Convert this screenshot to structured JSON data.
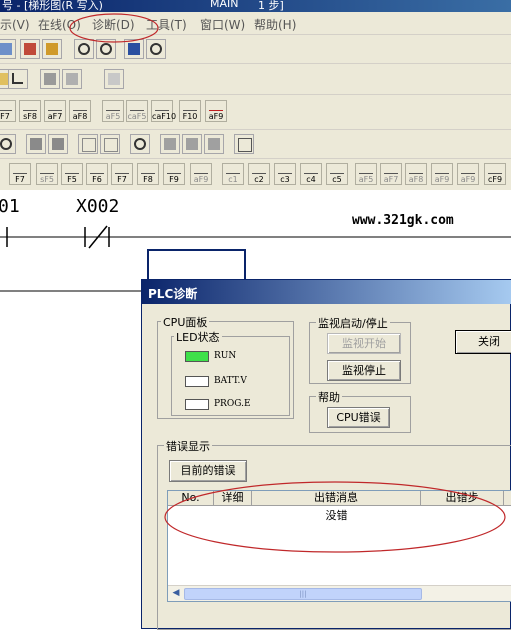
{
  "titlebar": {
    "fragment1": "号 - [梯形图(R 写入)",
    "fragment2": "MAIN",
    "fragment3": "1 步]"
  },
  "menu": {
    "items": [
      "示(V)",
      "在线(O)",
      "诊断(D)",
      "工具(T)",
      "窗口(W)",
      "帮助(H)"
    ]
  },
  "toolbar_keys": {
    "row3": [
      "F7",
      "sF8",
      "aF7",
      "aF8",
      "aF5",
      "caF5",
      "caF10",
      "F10",
      "aF9"
    ],
    "row5": [
      "F7",
      "sF5",
      "F5",
      "F6",
      "F7",
      "F8",
      "F9",
      "aF9",
      "c1",
      "c2",
      "c3",
      "c4",
      "c5",
      "aF5",
      "aF7",
      "aF8",
      "aF9",
      "aF9",
      "cF9"
    ]
  },
  "ladder": {
    "contact_left_label": "01",
    "contact_label": "X002",
    "watermark": "www.321gk.com"
  },
  "dialog": {
    "title": "PLC诊断",
    "cpu_panel": {
      "group_label": "CPU面板",
      "led_group_label": "LED状态",
      "leds": [
        {
          "label": "RUN",
          "color": "#3ee04a"
        },
        {
          "label": "BATT.V",
          "color": "#ffffff"
        },
        {
          "label": "PROG.E",
          "color": "#ffffff"
        }
      ]
    },
    "monitor": {
      "group_label": "监视启动/停止",
      "start_label": "监视开始",
      "stop_label": "监视停止"
    },
    "help": {
      "group_label": "帮助",
      "cpu_error_label": "CPU错误"
    },
    "close_label": "关闭",
    "errors": {
      "group_label": "错误显示",
      "current_error_label": "目前的错误",
      "columns": [
        "No.",
        "详细",
        "出错消息",
        "出错步"
      ],
      "row_message": "没错",
      "scroll_thumb_label": "|||"
    }
  },
  "annotation_color": "#c0282a"
}
